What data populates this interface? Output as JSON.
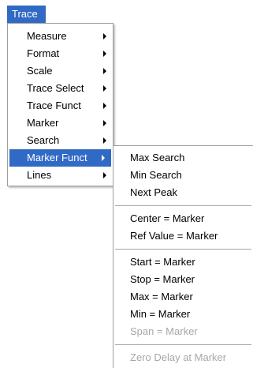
{
  "menubar": {
    "title": "Trace"
  },
  "main_menu": {
    "items": [
      {
        "label": "Measure",
        "has_submenu": true
      },
      {
        "label": "Format",
        "has_submenu": true
      },
      {
        "label": "Scale",
        "has_submenu": true
      },
      {
        "label": "Trace Select",
        "has_submenu": true
      },
      {
        "label": "Trace Funct",
        "has_submenu": true
      },
      {
        "label": "Marker",
        "has_submenu": true
      },
      {
        "label": "Search",
        "has_submenu": true
      },
      {
        "label": "Marker Funct",
        "has_submenu": true,
        "highlighted": true
      },
      {
        "label": "Lines",
        "has_submenu": true
      }
    ]
  },
  "submenu": {
    "groups": [
      [
        {
          "label": "Max Search",
          "enabled": true
        },
        {
          "label": "Min Search",
          "enabled": true
        },
        {
          "label": "Next Peak",
          "enabled": true
        }
      ],
      [
        {
          "label": "Center = Marker",
          "enabled": true
        },
        {
          "label": "Ref Value = Marker",
          "enabled": true
        }
      ],
      [
        {
          "label": "Start = Marker",
          "enabled": true
        },
        {
          "label": "Stop = Marker",
          "enabled": true
        },
        {
          "label": "Max = Marker",
          "enabled": true
        },
        {
          "label": "Min = Marker",
          "enabled": true
        },
        {
          "label": "Span = Marker",
          "enabled": false
        }
      ],
      [
        {
          "label": "Zero Delay at Marker",
          "enabled": false
        }
      ]
    ]
  },
  "colors": {
    "highlight": "#316ac5",
    "disabled_text": "#a7a6aa"
  }
}
